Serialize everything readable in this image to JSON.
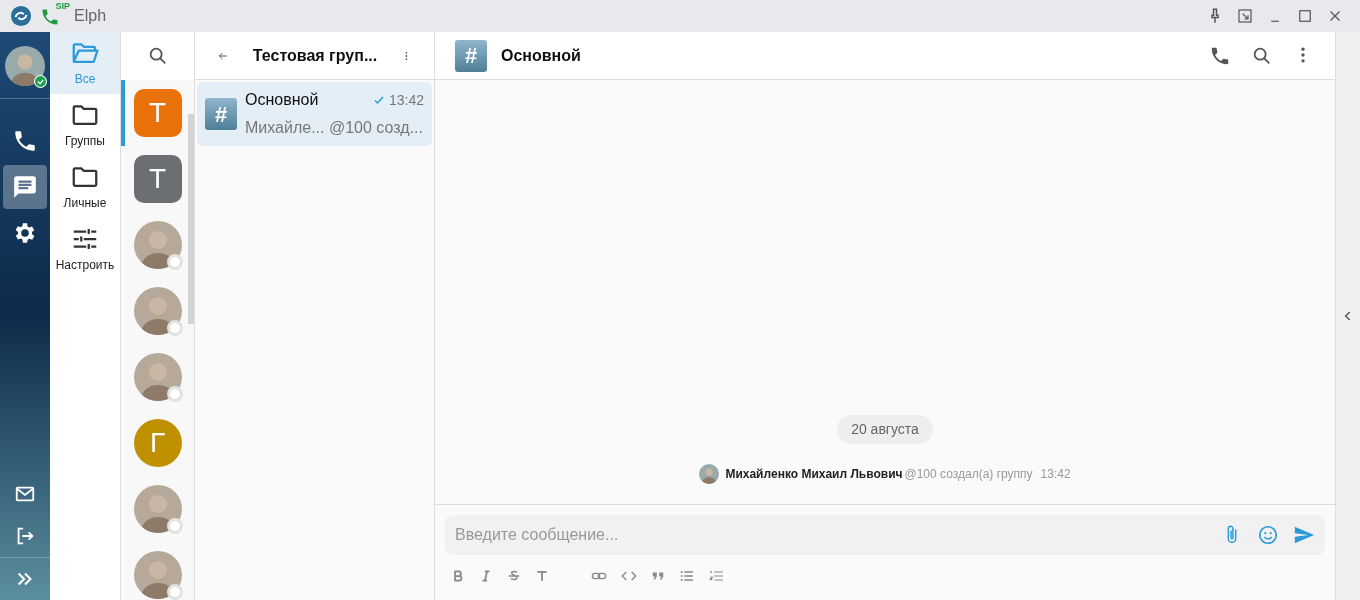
{
  "window": {
    "title": "Elph",
    "logo_badge": "SIP"
  },
  "rail": {
    "profile": {
      "online": true
    },
    "items": [
      {
        "kind": "phone",
        "selected": false
      },
      {
        "kind": "chat",
        "selected": true
      },
      {
        "kind": "settings",
        "selected": false
      }
    ],
    "bottom": [
      {
        "kind": "mail"
      },
      {
        "kind": "logout"
      },
      {
        "kind": "expand"
      }
    ]
  },
  "folders": [
    {
      "kind": "open",
      "label": "Все",
      "selected": true
    },
    {
      "kind": "folder",
      "label": "Группы",
      "selected": false
    },
    {
      "kind": "folder",
      "label": "Личные",
      "selected": false
    },
    {
      "kind": "tune",
      "label": "Настроить",
      "selected": false
    }
  ],
  "contacts": [
    {
      "kind": "tile",
      "letter": "Т",
      "color": "#e8710a",
      "selected": true
    },
    {
      "kind": "tile",
      "letter": "Т",
      "color": "#6b6f74",
      "selected": false
    },
    {
      "kind": "photo",
      "selected": false
    },
    {
      "kind": "photo",
      "selected": false
    },
    {
      "kind": "photo",
      "selected": false
    },
    {
      "kind": "round",
      "letter": "Г",
      "color": "#bf9000",
      "selected": false
    },
    {
      "kind": "photo",
      "selected": false
    },
    {
      "kind": "photo",
      "selected": false
    }
  ],
  "chat_list": {
    "title": "Тестовая груп...",
    "chats": [
      {
        "icon": "#",
        "title": "Основной",
        "time": "13:42",
        "preview": "Михайле... @100 созд...",
        "read": true,
        "selected": true
      }
    ]
  },
  "conversation": {
    "icon": "#",
    "title": "Основной",
    "date": "20 августа",
    "event": {
      "author": "Михайленко Михаил Львович",
      "handle": "@100",
      "text": "создал(а) группу",
      "time": "13:42"
    },
    "composer": {
      "placeholder": "Введите сообщение..."
    }
  }
}
